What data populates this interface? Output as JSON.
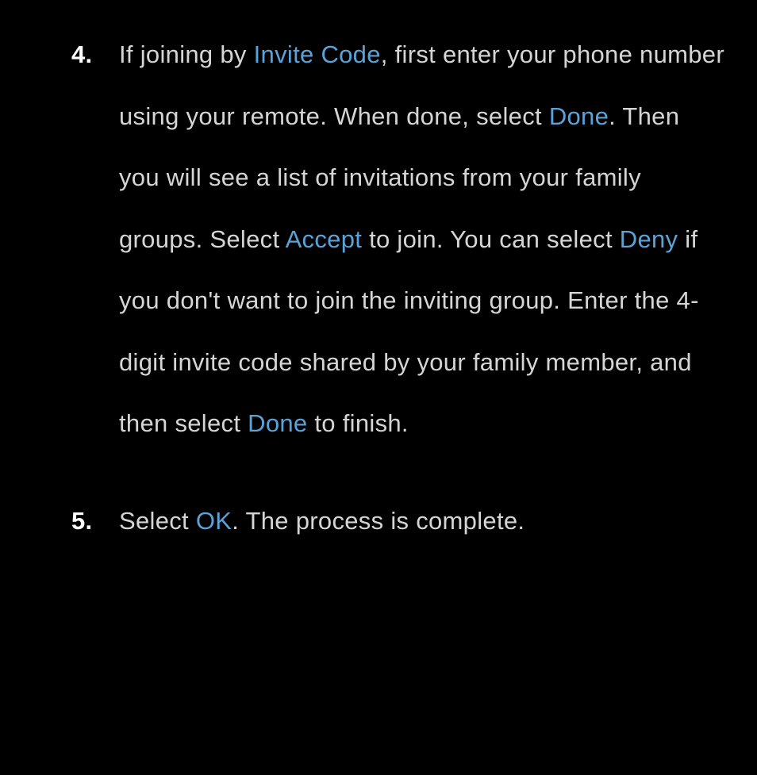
{
  "steps": {
    "item4": {
      "t1": "If joining by ",
      "h1": "Invite Code",
      "t2": ", first enter your phone number using your remote. When done, select ",
      "h2": "Done",
      "t3": ". Then you will see a list of invitations from your family groups. Select ",
      "h3": "Accept",
      "t4": " to join. You can select ",
      "h4": "Deny",
      "t5": " if you don't want to join the inviting group. Enter the 4-digit invite code shared by your family member, and then select ",
      "h5": "Done",
      "t6": " to finish."
    },
    "item5": {
      "t1": "Select ",
      "h1": "OK",
      "t2": ". The process is complete."
    }
  }
}
